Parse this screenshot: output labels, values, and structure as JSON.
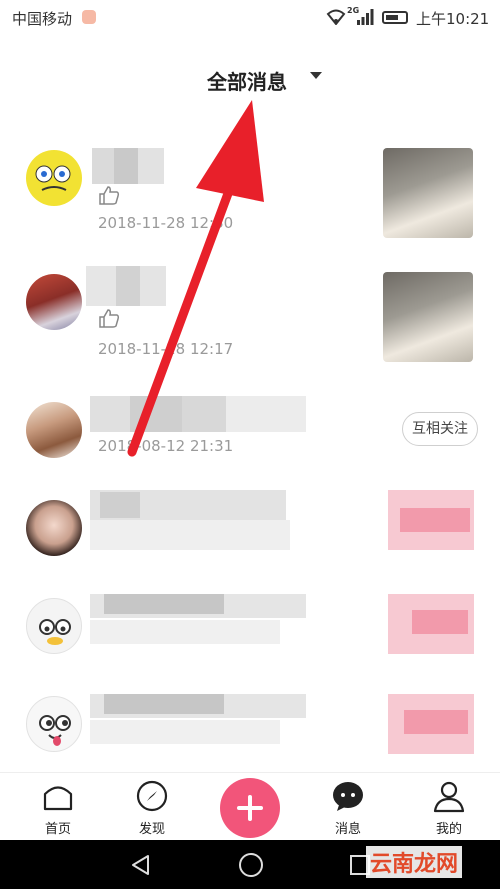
{
  "status_bar": {
    "carrier": "中国移动",
    "network": "2G",
    "time": "上午10:21"
  },
  "header": {
    "title": "全部消息"
  },
  "messages": [
    {
      "time": "2018-11-28 12:30",
      "type": "like"
    },
    {
      "time": "2018-11-28 12:17",
      "type": "like"
    },
    {
      "time": "2018-08-12 21:31",
      "type": "follow",
      "action_label": "互相关注"
    },
    {
      "type": "pixelated"
    },
    {
      "type": "pixelated"
    },
    {
      "type": "pixelated"
    }
  ],
  "bottom_nav": {
    "items": [
      {
        "label": "首页",
        "icon": "home-icon"
      },
      {
        "label": "发现",
        "icon": "compass-icon"
      },
      {
        "label": "",
        "icon": "plus-icon"
      },
      {
        "label": "消息",
        "icon": "chat-bubble-icon"
      },
      {
        "label": "我的",
        "icon": "profile-icon"
      }
    ]
  },
  "watermark": "云南龙网",
  "colors": {
    "accent": "#f2557a",
    "arrow": "#e8202a",
    "time_text": "#9a9a9a"
  }
}
